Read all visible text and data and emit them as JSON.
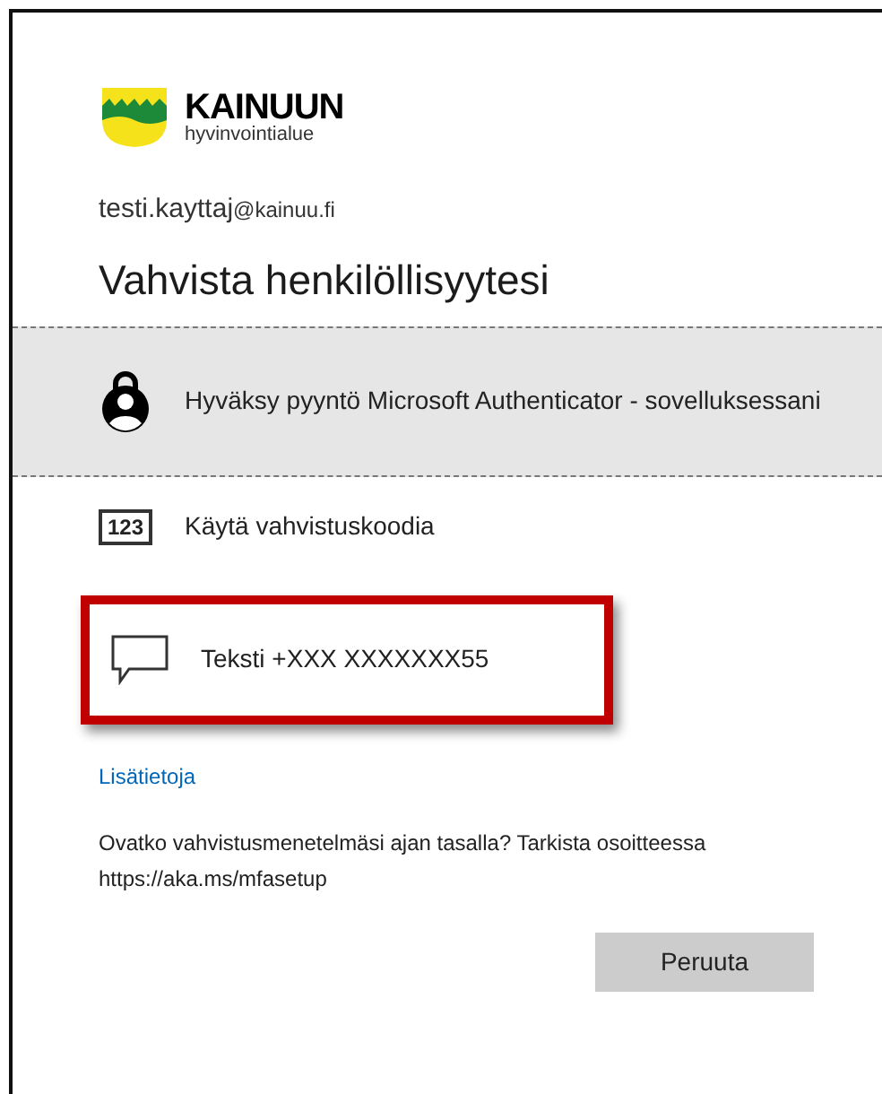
{
  "logo": {
    "name": "KAINUUN",
    "subtitle": "hyvinvointialue"
  },
  "account": {
    "user": "testi.kayttaj",
    "domain": "@kainuu.fi"
  },
  "title": "Vahvista henkilöllisyytesi",
  "options": [
    {
      "kind": "authenticator",
      "label": "Hyväksy pyyntö Microsoft Authenticator - sovelluksessani",
      "selected": true,
      "highlighted": false
    },
    {
      "kind": "code",
      "icon_text": "123",
      "label": "Käytä vahvistuskoodia",
      "selected": false,
      "highlighted": false
    },
    {
      "kind": "sms",
      "label": "Teksti +XXX XXXXXXX55",
      "selected": false,
      "highlighted": true
    }
  ],
  "more_info_link": "Lisätietoja",
  "notice": "Ovatko vahvistusmenetelmäsi ajan tasalla? Tarkista osoitteessa https://aka.ms/mfasetup",
  "cancel_button": "Peruuta"
}
